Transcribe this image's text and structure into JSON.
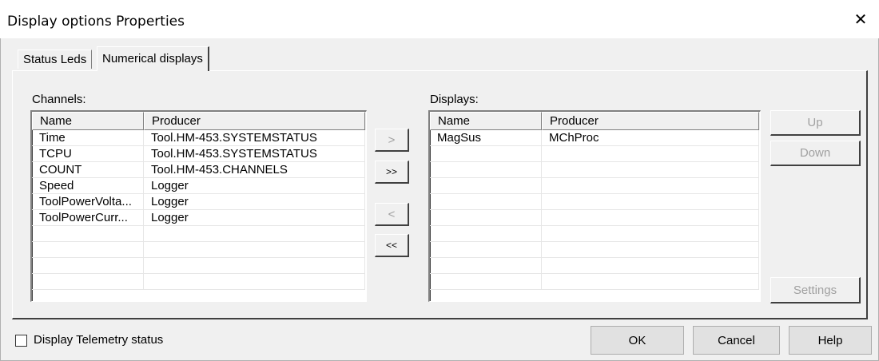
{
  "window": {
    "title": "Display options Properties",
    "close_glyph": "✕"
  },
  "tabs": [
    {
      "label": "Status Leds",
      "active": false
    },
    {
      "label": "Numerical displays",
      "active": true
    }
  ],
  "channels": {
    "label": "Channels:",
    "columns": [
      "Name",
      "Producer"
    ],
    "rows": [
      [
        "Time",
        "Tool.HM-453.SYSTEMSTATUS"
      ],
      [
        "TCPU",
        "Tool.HM-453.SYSTEMSTATUS"
      ],
      [
        "COUNT",
        "Tool.HM-453.CHANNELS"
      ],
      [
        "Speed",
        "Logger"
      ],
      [
        "ToolPowerVolta...",
        "Logger"
      ],
      [
        "ToolPowerCurr...",
        "Logger"
      ],
      [
        "",
        ""
      ],
      [
        "",
        ""
      ],
      [
        "",
        ""
      ],
      [
        "",
        ""
      ]
    ]
  },
  "displays": {
    "label": "Displays:",
    "columns": [
      "Name",
      "Producer"
    ],
    "rows": [
      [
        "MagSus",
        "MChProc"
      ],
      [
        "",
        ""
      ],
      [
        "",
        ""
      ],
      [
        "",
        ""
      ],
      [
        "",
        ""
      ],
      [
        "",
        ""
      ],
      [
        "",
        ""
      ],
      [
        "",
        ""
      ],
      [
        "",
        ""
      ],
      [
        "",
        ""
      ]
    ]
  },
  "transfer_buttons": {
    "add": ">",
    "add_all": ">>",
    "remove": "<",
    "remove_all": "<<"
  },
  "side_buttons": {
    "up": "Up",
    "down": "Down",
    "settings": "Settings"
  },
  "footer": {
    "telemetry_checkbox_label": "Display Telemetry status",
    "telemetry_checked": false,
    "ok": "OK",
    "cancel": "Cancel",
    "help": "Help"
  }
}
